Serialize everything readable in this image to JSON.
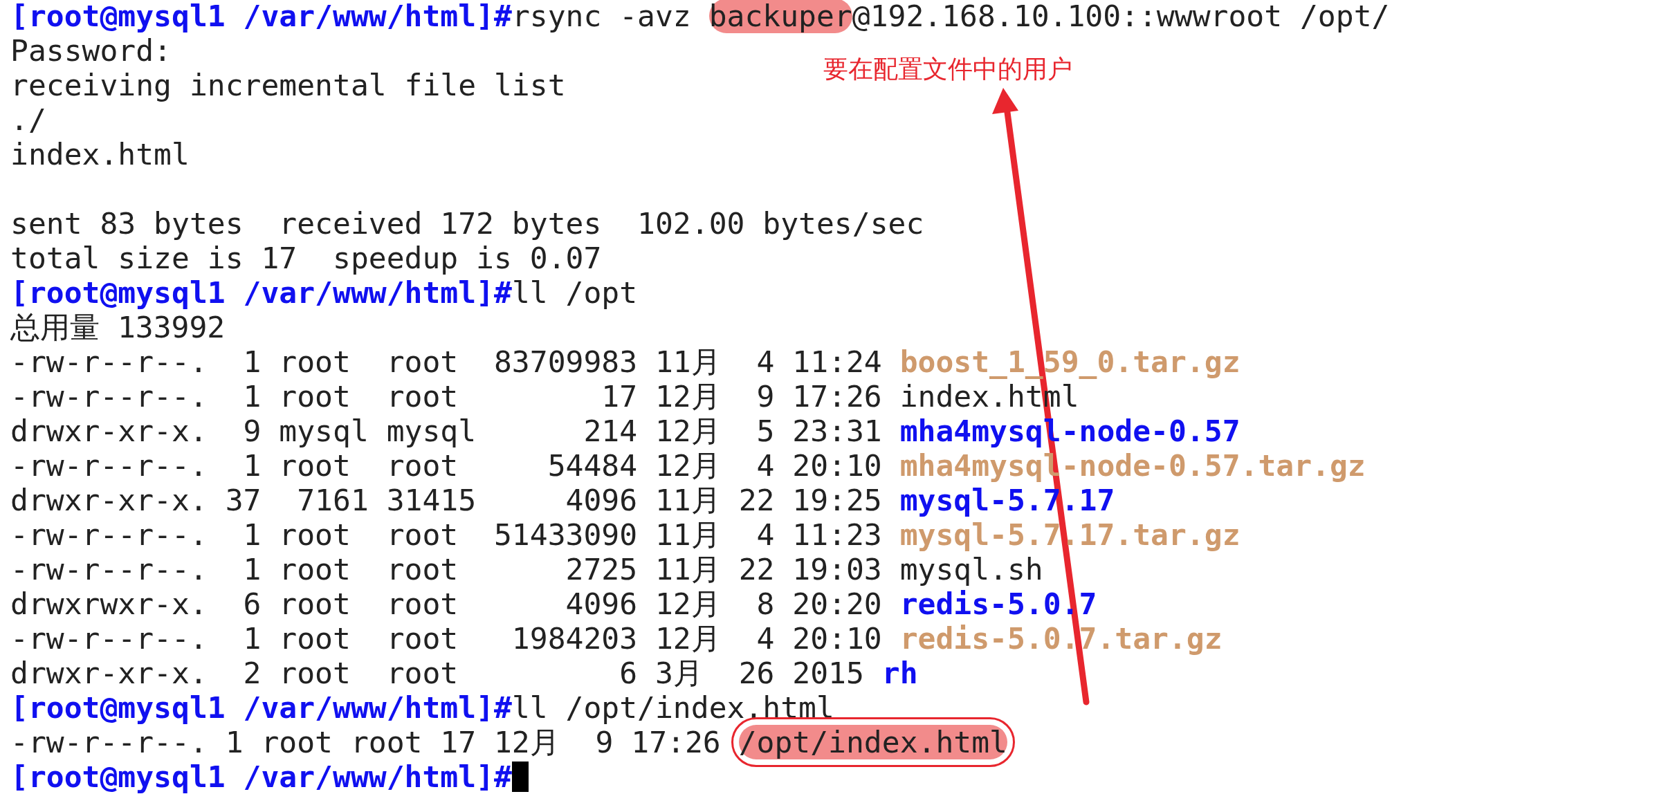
{
  "terminal": {
    "lines": [
      {
        "kind": "output",
        "segments": [
          {
            "kind": "prompt",
            "text": "[root@mysql1 /var/www/html]#"
          },
          {
            "kind": "plain",
            "text": "rsync -avz "
          },
          {
            "kind": "plain",
            "text": "backuper",
            "highlighted": true
          },
          {
            "kind": "plain",
            "text": "@192.168.10.100::wwwroot /opt/"
          }
        ]
      },
      {
        "kind": "output",
        "segments": [
          {
            "kind": "plain",
            "text": "Password:"
          }
        ]
      },
      {
        "kind": "output",
        "segments": [
          {
            "kind": "plain",
            "text": "receiving incremental file list"
          }
        ]
      },
      {
        "kind": "output",
        "segments": [
          {
            "kind": "plain",
            "text": "./"
          }
        ]
      },
      {
        "kind": "output",
        "segments": [
          {
            "kind": "plain",
            "text": "index.html"
          }
        ]
      },
      {
        "kind": "blank"
      },
      {
        "kind": "output",
        "segments": [
          {
            "kind": "plain",
            "text": "sent 83 bytes  received 172 bytes  102.00 bytes/sec"
          }
        ]
      },
      {
        "kind": "output",
        "segments": [
          {
            "kind": "plain",
            "text": "total size is 17  speedup is 0.07"
          }
        ]
      },
      {
        "kind": "output",
        "segments": [
          {
            "kind": "prompt",
            "text": "[root@mysql1 /var/www/html]#"
          },
          {
            "kind": "plain",
            "text": "ll /opt"
          }
        ]
      },
      {
        "kind": "output",
        "segments": [
          {
            "kind": "plain",
            "text": "总用量 133992"
          }
        ]
      },
      {
        "kind": "output",
        "segments": [
          {
            "kind": "plain",
            "text": "-rw-r--r--.  1 root  root  83709983 11月  4 11:24 "
          },
          {
            "kind": "archive",
            "text": "boost_1_59_0.tar.gz"
          }
        ]
      },
      {
        "kind": "output",
        "segments": [
          {
            "kind": "plain",
            "text": "-rw-r--r--.  1 root  root        17 12月  9 17:26 "
          },
          {
            "kind": "plain",
            "text": "index.html"
          }
        ]
      },
      {
        "kind": "output",
        "segments": [
          {
            "kind": "plain",
            "text": "drwxr-xr-x.  9 mysql mysql      214 12月  5 23:31 "
          },
          {
            "kind": "dir",
            "text": "mha4mysql-node-0.57"
          }
        ]
      },
      {
        "kind": "output",
        "segments": [
          {
            "kind": "plain",
            "text": "-rw-r--r--.  1 root  root     54484 12月  4 20:10 "
          },
          {
            "kind": "archive",
            "text": "mha4mysql-node-0.57.tar.gz"
          }
        ]
      },
      {
        "kind": "output",
        "segments": [
          {
            "kind": "plain",
            "text": "drwxr-xr-x. 37  7161 31415     4096 11月 22 19:25 "
          },
          {
            "kind": "dir",
            "text": "mysql-5.7.17"
          }
        ]
      },
      {
        "kind": "output",
        "segments": [
          {
            "kind": "plain",
            "text": "-rw-r--r--.  1 root  root  51433090 11月  4 11:23 "
          },
          {
            "kind": "archive",
            "text": "mysql-5.7.17.tar.gz"
          }
        ]
      },
      {
        "kind": "output",
        "segments": [
          {
            "kind": "plain",
            "text": "-rw-r--r--.  1 root  root      2725 11月 22 19:03 "
          },
          {
            "kind": "plain",
            "text": "mysql.sh"
          }
        ]
      },
      {
        "kind": "output",
        "segments": [
          {
            "kind": "plain",
            "text": "drwxrwxr-x.  6 root  root      4096 12月  8 20:20 "
          },
          {
            "kind": "dir",
            "text": "redis-5.0.7"
          }
        ]
      },
      {
        "kind": "output",
        "segments": [
          {
            "kind": "plain",
            "text": "-rw-r--r--.  1 root  root   1984203 12月  4 20:10 "
          },
          {
            "kind": "archive",
            "text": "redis-5.0.7.tar.gz"
          }
        ]
      },
      {
        "kind": "output",
        "segments": [
          {
            "kind": "plain",
            "text": "drwxr-xr-x.  2 root  root         6 3月  26 2015 "
          },
          {
            "kind": "dir",
            "text": "rh"
          }
        ]
      },
      {
        "kind": "output",
        "segments": [
          {
            "kind": "prompt",
            "text": "[root@mysql1 /var/www/html]#"
          },
          {
            "kind": "plain",
            "text": "ll /opt/index.html"
          }
        ]
      },
      {
        "kind": "output",
        "segments": [
          {
            "kind": "plain",
            "text": "-rw-r--r--. 1 root root 17 12月  9 17:26 "
          },
          {
            "kind": "plain",
            "text": "/opt/index.html",
            "highlighted": true,
            "boxed": true
          }
        ]
      },
      {
        "kind": "output",
        "cursor": true,
        "segments": [
          {
            "kind": "prompt",
            "text": "[root@mysql1 /var/www/html]#"
          }
        ]
      }
    ]
  },
  "annotation": {
    "note": "要在配置文件中的用户"
  }
}
